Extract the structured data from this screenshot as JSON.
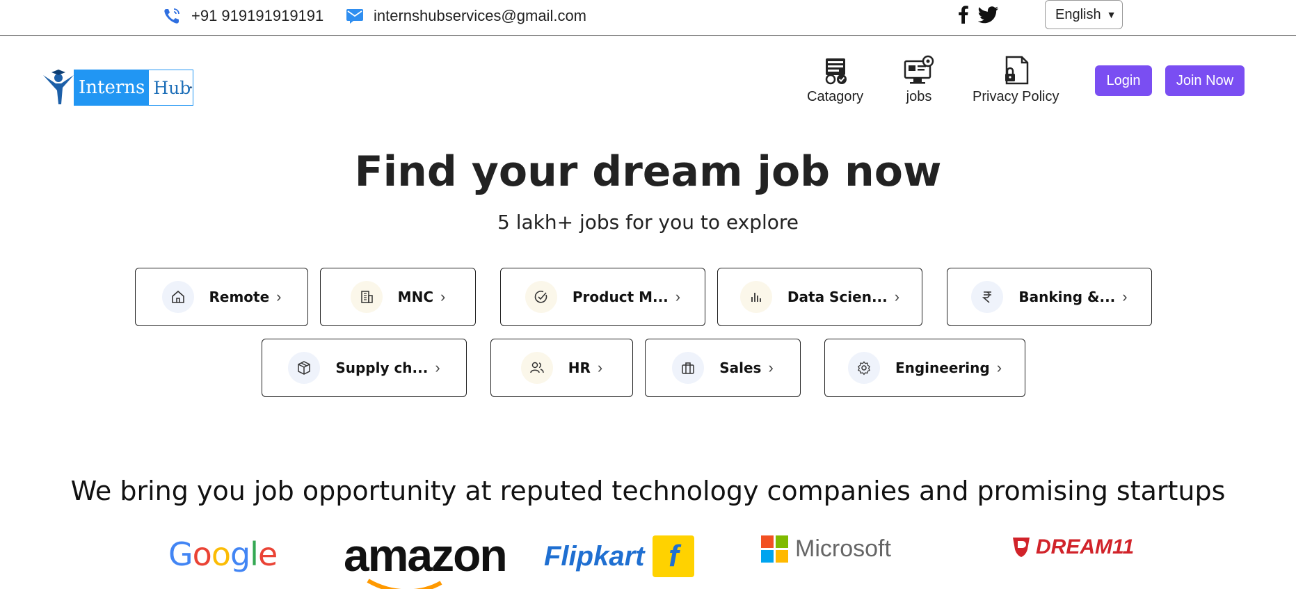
{
  "topbar": {
    "phone": "+91 919191919191",
    "email": "internshubservices@gmail.com",
    "language": "English"
  },
  "logo": {
    "part1": "Interns",
    "part2": "Hub"
  },
  "nav": {
    "category": "Catagory",
    "jobs": "jobs",
    "privacy": "Privacy Policy",
    "login": "Login",
    "join": "Join Now"
  },
  "hero": {
    "title": "Find your dream job now",
    "subtitle": "5 lakh+ jobs for you to explore"
  },
  "categories": [
    {
      "label": "Remote",
      "icon": "home-icon"
    },
    {
      "label": "MNC",
      "icon": "building-icon"
    },
    {
      "label": "Product M...",
      "icon": "check-circle-icon"
    },
    {
      "label": "Data Scien...",
      "icon": "bar-chart-icon"
    },
    {
      "label": "Banking &...",
      "icon": "rupee-icon"
    },
    {
      "label": "Supply ch...",
      "icon": "box-icon"
    },
    {
      "label": "HR",
      "icon": "users-icon"
    },
    {
      "label": "Sales",
      "icon": "briefcase-icon"
    },
    {
      "label": "Engineering",
      "icon": "gear-icon"
    }
  ],
  "arrow": "›",
  "companies": {
    "title": "We bring you job opportunity at reputed technology companies and promising startups",
    "google": [
      "G",
      "o",
      "o",
      "g",
      "l",
      "e"
    ],
    "amazon": "amazon",
    "flipkart": "Flipkart",
    "flipkart_bag": "f",
    "microsoft": "Microsoft",
    "dream11": "DREAM11"
  },
  "colors": {
    "accent": "#7a4ef2",
    "logo_blue": "#2196f3",
    "google": [
      "#4285F4",
      "#EA4335",
      "#FBBC05",
      "#4285F4",
      "#34A853",
      "#EA4335"
    ],
    "microsoft": [
      "#F25022",
      "#7FBA00",
      "#00A4EF",
      "#FFB900"
    ]
  }
}
